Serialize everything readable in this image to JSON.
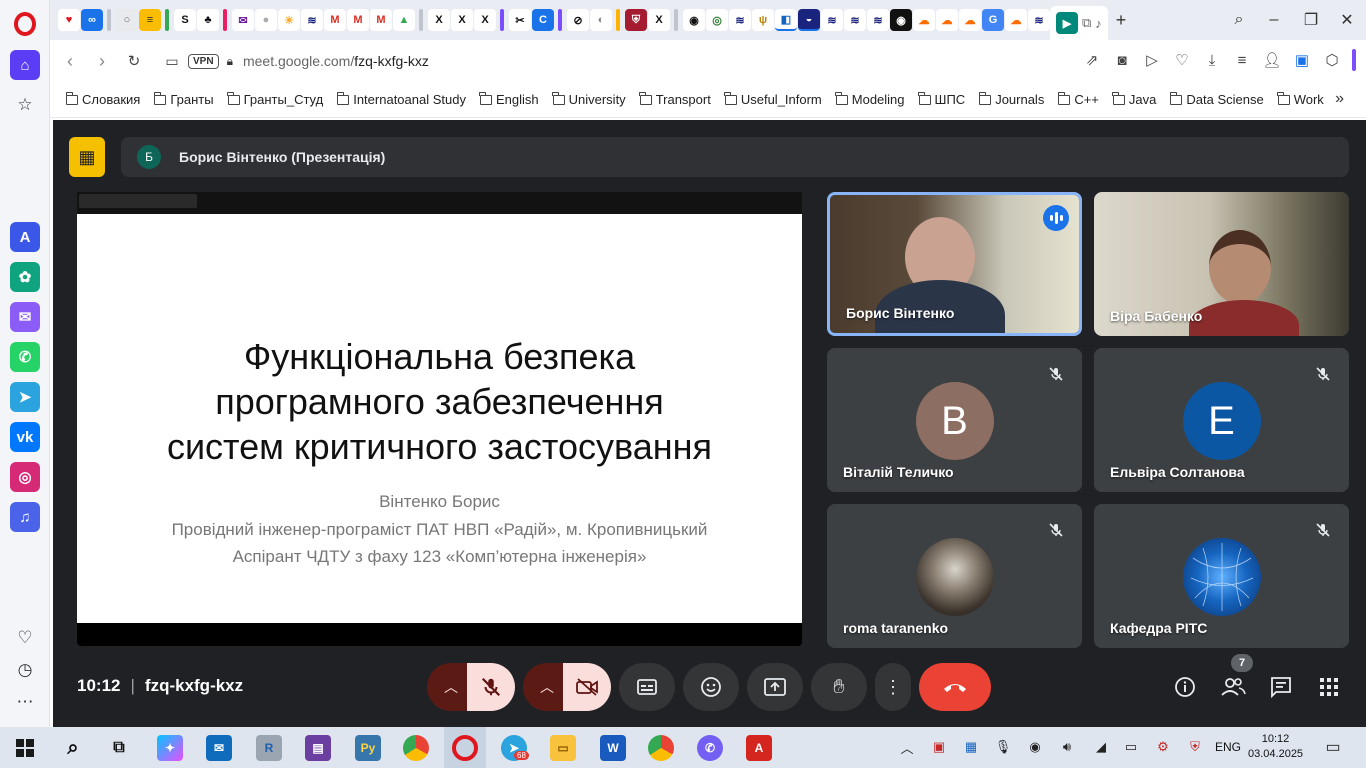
{
  "browser": {
    "url_host": "meet.google.com/",
    "url_path": "fzq-kxfg-kxz",
    "vpn_label": "VPN"
  },
  "bookmarks": [
    "Словакия",
    "Гранты",
    "Гранты_Студ",
    "Internatoanal Study",
    "English",
    "University",
    "Transport",
    "Useful_Inform",
    "Modeling",
    "ШПС",
    "Journals",
    "C++",
    "Java",
    "Data Sciense",
    "Work"
  ],
  "meet": {
    "presenter_initial": "Б",
    "presenter_bar_title": "Борис Вінтенко (Презентація)",
    "slide": {
      "title_line1": "Функціональна безпека",
      "title_line2": "програмного забезпечення",
      "title_line3": "систем критичного застосування",
      "author_line1": "Вінтенко Борис",
      "author_line2": "Провідний інженер-програміст ПАТ НВП «Радій», м. Кропивницький",
      "author_line3": "Аспірант ЧДТУ з фаху 123 «Комп’ютерна інженерія»"
    },
    "participants": [
      {
        "name": "Борис Вінтенко",
        "type": "video",
        "speaking": true
      },
      {
        "name": "Віра Бабенко",
        "type": "video",
        "speaking": false
      },
      {
        "name": "Віталій Теличко",
        "type": "avatar",
        "initial": "В",
        "color": "#8d6e63",
        "muted": true
      },
      {
        "name": "Ельвіра Солтанова",
        "type": "avatar",
        "initial": "E",
        "color": "#0b57a4",
        "muted": true
      },
      {
        "name": "roma taranenko",
        "type": "photo",
        "muted": true
      },
      {
        "name": "Кафедра РІТС",
        "type": "photo",
        "muted": true
      }
    ],
    "time": "10:12",
    "meeting_code": "fzq-kxfg-kxz",
    "participant_count": "7"
  },
  "taskbar": {
    "time": "10:12",
    "date": "03.04.2025",
    "lang": "ENG",
    "telegram_badge": "68"
  }
}
